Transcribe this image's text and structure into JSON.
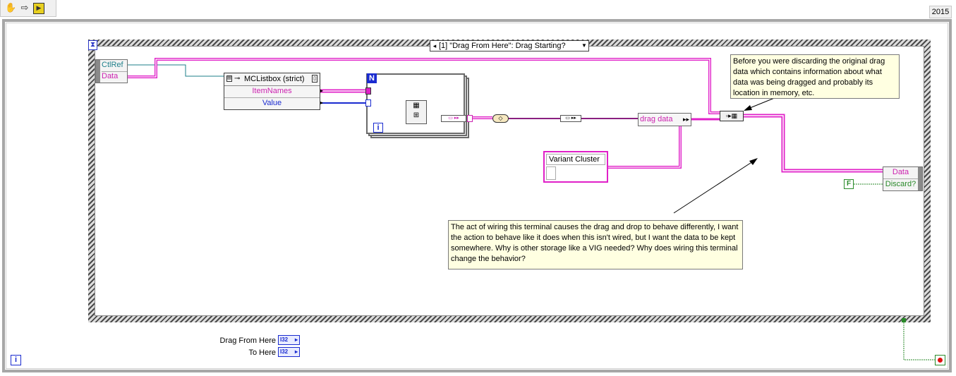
{
  "toolbar": {
    "icons": [
      "hand-icon",
      "arrow-right-icon",
      "highlight-execution-icon"
    ],
    "version": "2015"
  },
  "event_case": {
    "selector_label": "[1] \"Drag From Here\": Drag Starting?"
  },
  "event_data_node": {
    "rows": [
      "CtlRef",
      "Data"
    ]
  },
  "property_node": {
    "title": "MCListbox (strict)",
    "properties": [
      "ItemNames",
      "Value"
    ]
  },
  "for_loop": {
    "count_terminal": "N",
    "iteration_terminal": "i"
  },
  "drag_data_label": "drag data",
  "variant_cluster_label": "Variant Cluster",
  "output_node": {
    "rows": [
      "Data",
      "Discard?"
    ]
  },
  "false_constant": "F",
  "comments": {
    "top": "Before you were discarding the original drag data which contains information about what data was being dragged and probably its location in memory, etc.",
    "bottom": "The act of wiring this terminal causes the drag and drop to behave differently, I want the action to behave like it does when this isn't wired, but I want the data to be kept somewhere.  Why is other storage like a VIG needed?  Why does wiring this terminal change the behavior?"
  },
  "controls": {
    "drag_from_here": "Drag From Here",
    "to_here": "To Here",
    "type": "I32"
  },
  "loop_iteration_terminal": "i",
  "colors": {
    "variant_wire": "#e020c8",
    "refnum_wire": "#1e7f8a",
    "numeric_wire": "#1a2bd0",
    "boolean_wire": "#2a8a2a"
  }
}
